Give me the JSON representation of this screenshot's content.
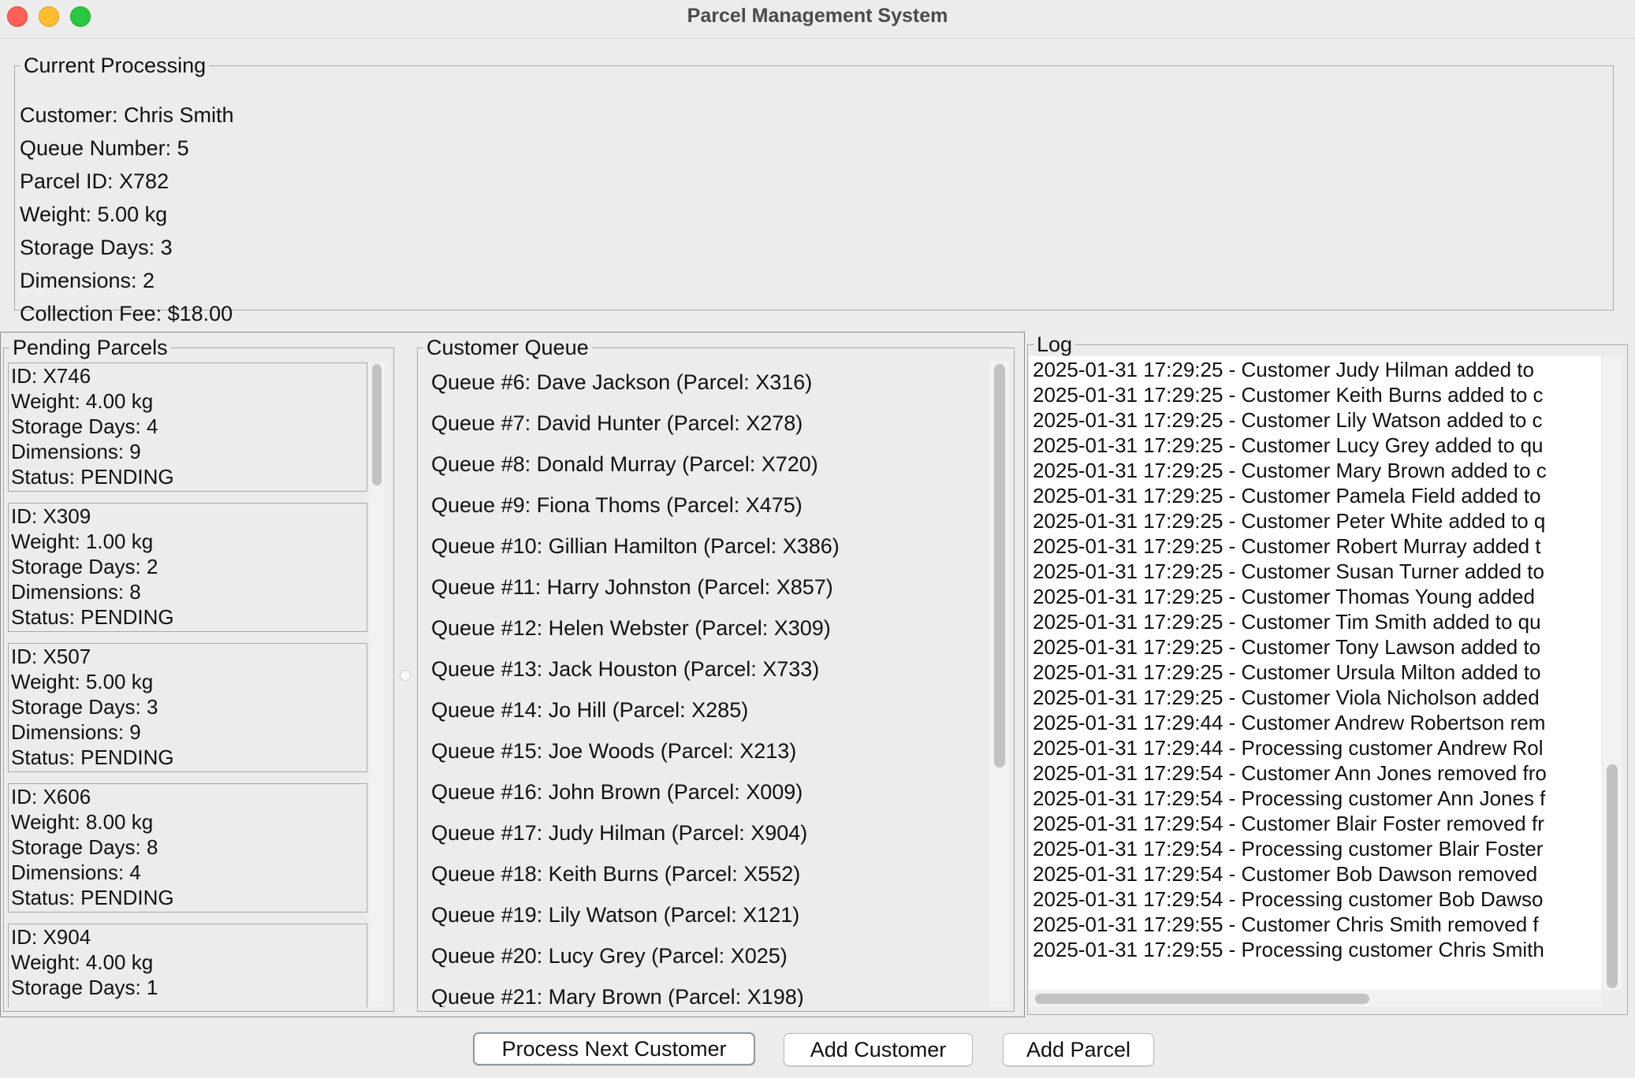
{
  "window": {
    "title": "Parcel Management System"
  },
  "current_processing": {
    "legend": "Current Processing",
    "lines": [
      "Customer: Chris Smith",
      "Queue Number: 5",
      "Parcel ID: X782",
      "Weight: 5.00 kg",
      "Storage Days: 3",
      "Dimensions: 2",
      "Collection Fee: $18.00"
    ]
  },
  "pending": {
    "legend": "Pending Parcels",
    "parcels": [
      {
        "id": "ID: X746",
        "weight": "Weight: 4.00 kg",
        "storage": "Storage Days: 4",
        "dimensions": "Dimensions: 9",
        "status": "Status: PENDING"
      },
      {
        "id": "ID: X309",
        "weight": "Weight: 1.00 kg",
        "storage": "Storage Days: 2",
        "dimensions": "Dimensions: 8",
        "status": "Status: PENDING"
      },
      {
        "id": "ID: X507",
        "weight": "Weight: 5.00 kg",
        "storage": "Storage Days: 3",
        "dimensions": "Dimensions: 9",
        "status": "Status: PENDING"
      },
      {
        "id": "ID: X606",
        "weight": "Weight: 8.00 kg",
        "storage": "Storage Days: 8",
        "dimensions": "Dimensions: 4",
        "status": "Status: PENDING"
      },
      {
        "id": "ID: X904",
        "weight": "Weight: 4.00 kg",
        "storage": "Storage Days: 1",
        "dimensions": "",
        "status": ""
      }
    ]
  },
  "queue": {
    "legend": "Customer Queue",
    "items": [
      "Queue #6: Dave Jackson (Parcel: X316)",
      "Queue #7: David Hunter (Parcel: X278)",
      "Queue #8: Donald Murray (Parcel: X720)",
      "Queue #9: Fiona Thoms (Parcel: X475)",
      "Queue #10: Gillian Hamilton (Parcel: X386)",
      "Queue #11: Harry Johnston (Parcel: X857)",
      "Queue #12: Helen Webster (Parcel: X309)",
      "Queue #13: Jack Houston (Parcel: X733)",
      "Queue #14: Jo Hill (Parcel: X285)",
      "Queue #15: Joe Woods (Parcel: X213)",
      "Queue #16: John Brown (Parcel: X009)",
      "Queue #17: Judy Hilman (Parcel: X904)",
      "Queue #18: Keith Burns (Parcel: X552)",
      "Queue #19: Lily Watson (Parcel: X121)",
      "Queue #20: Lucy Grey (Parcel: X025)",
      "Queue #21: Mary Brown (Parcel: X198)"
    ]
  },
  "log": {
    "legend": "Log",
    "lines": [
      "2025-01-31 17:29:25 - Customer Judy Hilman added to",
      "2025-01-31 17:29:25 - Customer Keith Burns added to c",
      "2025-01-31 17:29:25 - Customer Lily Watson added to c",
      "2025-01-31 17:29:25 - Customer Lucy Grey added to qu",
      "2025-01-31 17:29:25 - Customer Mary Brown added to c",
      "2025-01-31 17:29:25 - Customer Pamela Field added to",
      "2025-01-31 17:29:25 - Customer Peter White added to q",
      "2025-01-31 17:29:25 - Customer Robert Murray added t",
      "2025-01-31 17:29:25 - Customer Susan Turner added to",
      "2025-01-31 17:29:25 - Customer Thomas Young added",
      "2025-01-31 17:29:25 - Customer Tim Smith added to qu",
      "2025-01-31 17:29:25 - Customer Tony Lawson added to",
      "2025-01-31 17:29:25 - Customer Ursula Milton added to",
      "2025-01-31 17:29:25 - Customer Viola Nicholson added",
      "2025-01-31 17:29:44 - Customer Andrew Robertson rem",
      "2025-01-31 17:29:44 - Processing customer Andrew Rol",
      "2025-01-31 17:29:54 - Customer Ann Jones removed fro",
      "2025-01-31 17:29:54 - Processing customer Ann Jones f",
      "2025-01-31 17:29:54 - Customer Blair Foster removed fr",
      "2025-01-31 17:29:54 - Processing customer Blair Foster",
      "2025-01-31 17:29:54 - Customer Bob Dawson removed",
      "2025-01-31 17:29:54 - Processing customer Bob Dawso",
      "2025-01-31 17:29:55 - Customer Chris Smith removed f",
      "2025-01-31 17:29:55 - Processing customer Chris Smith"
    ]
  },
  "buttons": {
    "process_next": "Process Next Customer",
    "add_customer": "Add Customer",
    "add_parcel": "Add Parcel"
  }
}
